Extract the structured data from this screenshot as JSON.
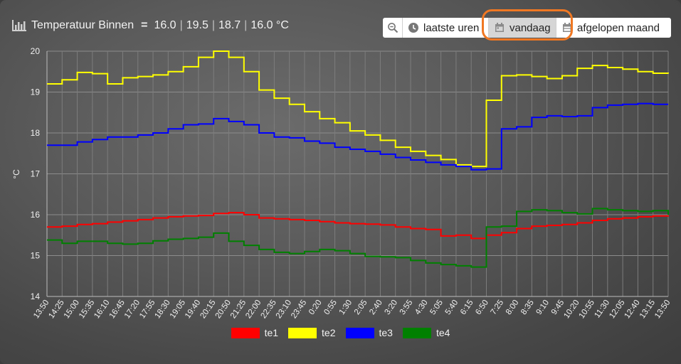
{
  "header": {
    "title": "Temperatuur Binnen",
    "separator": "=",
    "values": [
      "16.0",
      "19.5",
      "18.7",
      "16.0 °C"
    ]
  },
  "toolbar": {
    "zoom_icon": "zoom-out-icon",
    "hours_label": "laatste uren",
    "today_label": "vandaag",
    "month_label": "afgelopen maand",
    "active": "vandaag",
    "highlight_color": "#f07823"
  },
  "chart_data": {
    "type": "line",
    "xlabel": "",
    "ylabel": "°C",
    "ylim": [
      14,
      20
    ],
    "yticks": [
      14,
      15,
      16,
      17,
      18,
      19,
      20
    ],
    "grid": true,
    "legend_position": "bottom",
    "x": [
      "13:50",
      "14:25",
      "15:00",
      "15:35",
      "16:10",
      "16:45",
      "17:20",
      "17:55",
      "18:30",
      "19:05",
      "19:40",
      "20:15",
      "20:50",
      "21:25",
      "22:00",
      "22:35",
      "23:10",
      "23:45",
      "0:20",
      "0:55",
      "1:30",
      "2:05",
      "2:40",
      "3:20",
      "3:55",
      "4:30",
      "5:05",
      "5:40",
      "6:15",
      "6:50",
      "7:25",
      "8:00",
      "8:35",
      "9:10",
      "9:45",
      "10:20",
      "10:55",
      "11:30",
      "12:05",
      "12:40",
      "13:15",
      "13:50"
    ],
    "series": [
      {
        "name": "te1",
        "color": "#ff0000",
        "values": [
          15.7,
          15.72,
          15.76,
          15.78,
          15.82,
          15.85,
          15.88,
          15.92,
          15.95,
          15.97,
          15.98,
          16.03,
          16.05,
          16.0,
          15.92,
          15.9,
          15.88,
          15.86,
          15.83,
          15.8,
          15.78,
          15.77,
          15.75,
          15.7,
          15.66,
          15.64,
          15.48,
          15.5,
          15.42,
          15.5,
          15.56,
          15.66,
          15.72,
          15.74,
          15.76,
          15.8,
          15.86,
          15.9,
          15.92,
          15.95,
          15.97,
          15.98
        ]
      },
      {
        "name": "te2",
        "color": "#ffff00",
        "values": [
          19.2,
          19.3,
          19.48,
          19.45,
          19.2,
          19.35,
          19.38,
          19.42,
          19.5,
          19.62,
          19.85,
          20.0,
          19.85,
          19.5,
          19.05,
          18.85,
          18.7,
          18.52,
          18.35,
          18.25,
          18.05,
          17.95,
          17.82,
          17.65,
          17.55,
          17.45,
          17.35,
          17.22,
          17.18,
          18.8,
          19.4,
          19.42,
          19.38,
          19.33,
          19.4,
          19.58,
          19.65,
          19.6,
          19.56,
          19.5,
          19.46,
          19.45
        ]
      },
      {
        "name": "te3",
        "color": "#0000ff",
        "values": [
          17.7,
          17.7,
          17.78,
          17.84,
          17.9,
          17.9,
          17.95,
          18.0,
          18.1,
          18.2,
          18.22,
          18.35,
          18.28,
          18.2,
          18.0,
          17.9,
          17.88,
          17.8,
          17.75,
          17.65,
          17.6,
          17.55,
          17.48,
          17.4,
          17.34,
          17.28,
          17.22,
          17.18,
          17.1,
          17.12,
          18.1,
          18.15,
          18.38,
          18.42,
          18.4,
          18.42,
          18.62,
          18.68,
          18.7,
          18.72,
          18.7,
          18.7
        ]
      },
      {
        "name": "te4",
        "color": "#008000",
        "values": [
          15.38,
          15.3,
          15.35,
          15.35,
          15.3,
          15.28,
          15.3,
          15.36,
          15.4,
          15.42,
          15.45,
          15.55,
          15.35,
          15.25,
          15.15,
          15.08,
          15.05,
          15.1,
          15.15,
          15.12,
          15.05,
          14.98,
          14.97,
          14.95,
          14.88,
          14.82,
          14.78,
          14.75,
          14.72,
          15.7,
          15.72,
          16.08,
          16.12,
          16.1,
          16.05,
          16.02,
          16.15,
          16.12,
          16.1,
          16.08,
          16.1,
          16.0
        ]
      }
    ]
  }
}
